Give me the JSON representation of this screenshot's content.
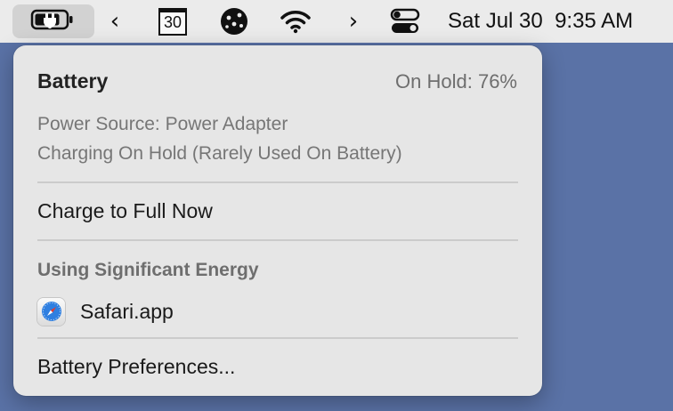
{
  "menubar": {
    "calendar_day": "30",
    "clock": "Sat Jul 30  9:35 AM",
    "icons": [
      "battery-charging-icon",
      "chevron-left-icon",
      "calendar-icon",
      "globe-icon",
      "wifi-icon",
      "chevron-right-icon",
      "control-center-icon"
    ]
  },
  "battery_menu": {
    "title": "Battery",
    "status": "On Hold: 76%",
    "power_source": "Power Source: Power Adapter",
    "charging_state": "Charging On Hold (Rarely Used On Battery)",
    "charge_full_label": "Charge to Full Now",
    "energy_heading": "Using Significant Energy",
    "apps": [
      {
        "name": "Safari.app",
        "icon": "safari-compass-icon"
      }
    ],
    "preferences_label": "Battery Preferences..."
  },
  "colors": {
    "desktop": "#5a72a6",
    "menubar": "#ebebeb",
    "menu_bg": "#e6e6e6",
    "safari_blue": "#2f7fe0"
  }
}
